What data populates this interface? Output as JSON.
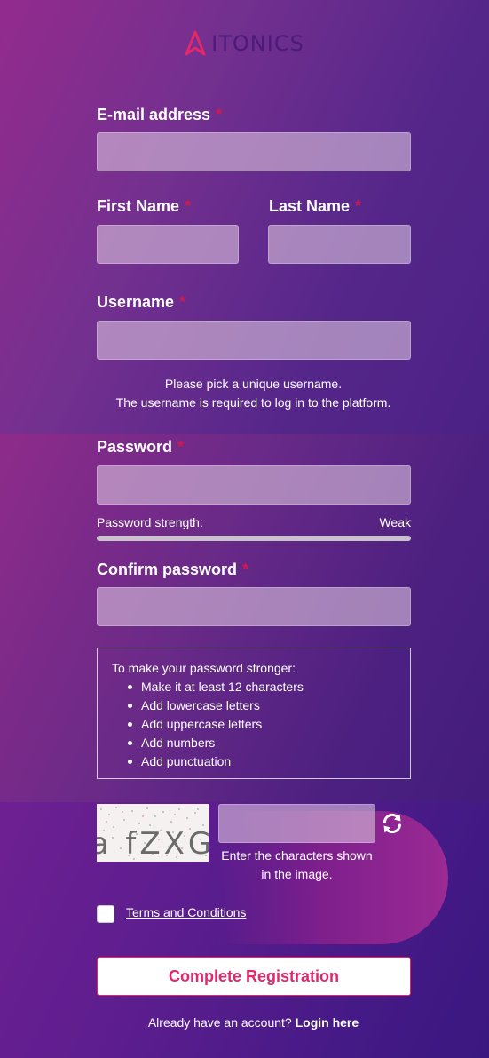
{
  "logo": {
    "text": "ITONICS"
  },
  "form": {
    "email": {
      "label": "E-mail address",
      "required_mark": "*",
      "value": ""
    },
    "first_name": {
      "label": "First Name",
      "required_mark": "*",
      "value": ""
    },
    "last_name": {
      "label": "Last Name",
      "required_mark": "*",
      "value": ""
    },
    "username": {
      "label": "Username",
      "required_mark": "*",
      "value": "",
      "hint_line1": "Please pick a unique username.",
      "hint_line2": "The username is required to log in to the platform."
    },
    "password": {
      "label": "Password",
      "required_mark": "*",
      "value": ""
    },
    "strength": {
      "label": "Password strength:",
      "value_text": "Weak",
      "level": 0
    },
    "confirm_password": {
      "label": "Confirm password",
      "required_mark": "*",
      "value": ""
    },
    "tips": {
      "title": "To make your password stronger:",
      "items": [
        "Make it at least 12 characters",
        "Add lowercase letters",
        "Add uppercase letters",
        "Add numbers",
        "Add punctuation"
      ]
    },
    "captcha": {
      "image_text": "a fZXG",
      "hint": "Enter the characters shown in the image.",
      "value": ""
    },
    "terms": {
      "label": "Terms and Conditions",
      "checked": false
    },
    "submit_label": "Complete Registration",
    "login_prompt": "Already have an account?",
    "login_link": "Login here"
  },
  "colors": {
    "accent": "#e3276b",
    "required": "#d01a4f",
    "logo_mark": "#e3276b",
    "logo_text": "#4b1a7a"
  },
  "icons": {
    "refresh": "refresh-icon",
    "logo": "itonics-logo-icon"
  }
}
